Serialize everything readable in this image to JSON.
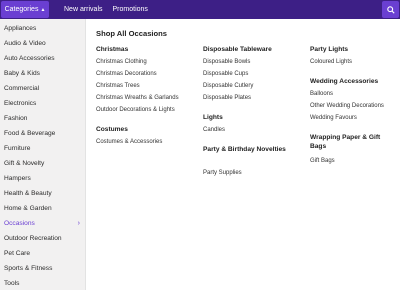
{
  "topbar": {
    "categories_label": "Categories",
    "nav": [
      "New arrivals",
      "Promotions"
    ],
    "search_icon": "search-icon"
  },
  "sidebar": {
    "items": [
      {
        "label": "Appliances"
      },
      {
        "label": "Audio & Video"
      },
      {
        "label": "Auto Accessories"
      },
      {
        "label": "Baby & Kids"
      },
      {
        "label": "Commercial"
      },
      {
        "label": "Electronics"
      },
      {
        "label": "Fashion"
      },
      {
        "label": "Food & Beverage"
      },
      {
        "label": "Furniture"
      },
      {
        "label": "Gift & Novelty"
      },
      {
        "label": "Hampers"
      },
      {
        "label": "Health & Beauty"
      },
      {
        "label": "Home & Garden"
      },
      {
        "label": "Occasions",
        "active": true
      },
      {
        "label": "Outdoor Recreation"
      },
      {
        "label": "Pet Care"
      },
      {
        "label": "Sports & Fitness"
      },
      {
        "label": "Tools"
      }
    ]
  },
  "main": {
    "title": "Shop All Occasions",
    "groups": [
      {
        "heading": "Christmas",
        "links": [
          "Christmas Clothing",
          "Christmas Decorations",
          "Christmas Trees",
          "Christmas Wreaths & Garlands",
          "Outdoor Decorations & Lights"
        ]
      },
      {
        "heading": "Costumes",
        "links": [
          "Costumes & Accessories"
        ]
      },
      {
        "heading": "Disposable Tableware",
        "links": [
          "Disposable Bowls",
          "Disposable Cups",
          "Disposable Cutlery",
          "Disposable Plates"
        ]
      },
      {
        "heading": "Lights",
        "links": [
          "Candles"
        ]
      },
      {
        "heading": "Party & Birthday Novelties",
        "links": [
          "Party Supplies"
        ]
      },
      {
        "heading": "Party Lights",
        "links": [
          "Coloured Lights"
        ]
      },
      {
        "heading": "Wedding Accessories",
        "links": [
          "Balloons",
          "Other Wedding Decorations",
          "Wedding Favours"
        ]
      },
      {
        "heading": "Wrapping Paper & Gift Bags",
        "links": [
          "Gift Bags"
        ]
      }
    ]
  },
  "colors": {
    "topbar": "#3d1f86",
    "accent": "#6a3fd2",
    "sidebar_bg": "#f2f1f1"
  }
}
